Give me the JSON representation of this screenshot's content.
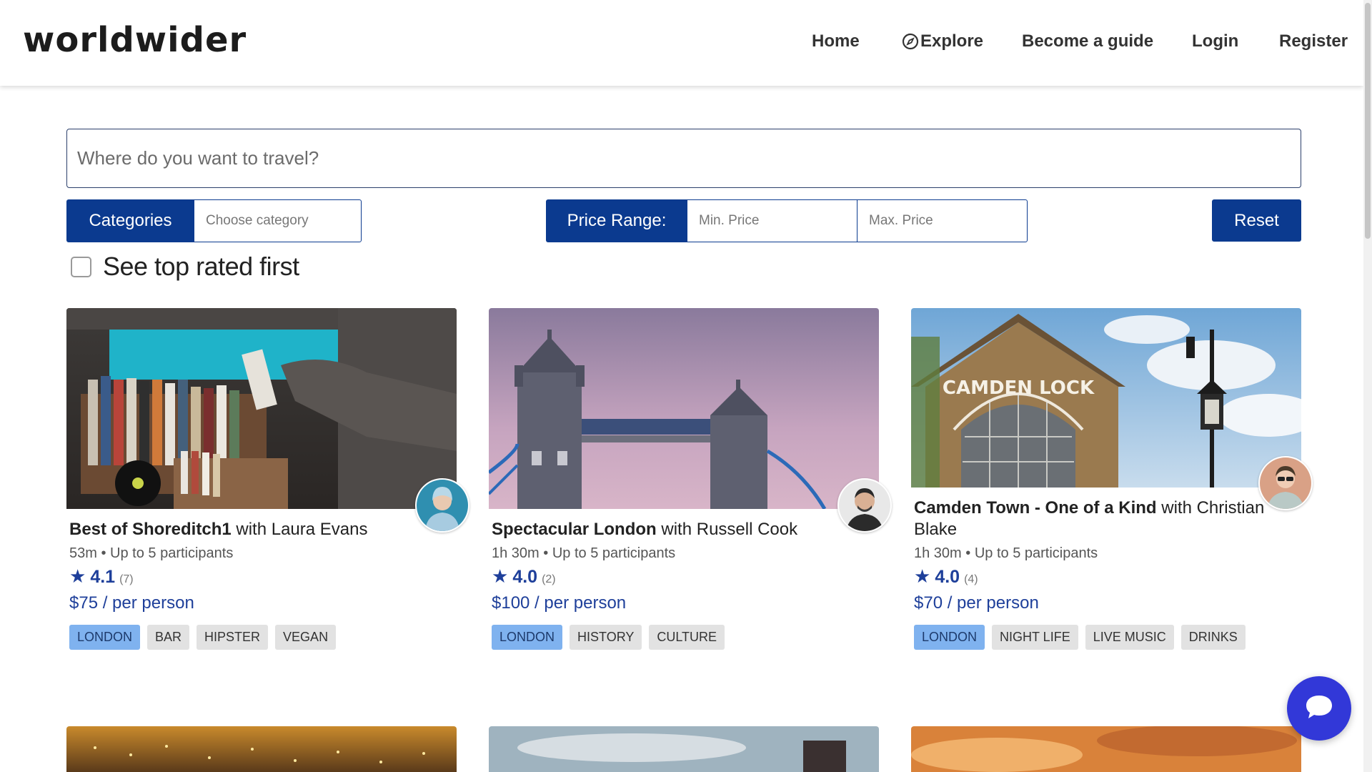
{
  "brand": {
    "logo": "worldwider"
  },
  "nav": {
    "home": "Home",
    "explore": "Explore",
    "become_guide": "Become a guide",
    "login": "Login",
    "register": "Register"
  },
  "search": {
    "placeholder": "Where do you want to travel?"
  },
  "filters": {
    "categories_label": "Categories",
    "category_placeholder": "Choose category",
    "price_label": "Price Range:",
    "min_placeholder": "Min. Price",
    "max_placeholder": "Max. Price",
    "reset_label": "Reset",
    "top_rated_label": "See top rated first",
    "top_rated_checked": false
  },
  "tours": [
    {
      "title": "Best of Shoreditch1",
      "guide_prefix": "with",
      "guide": "Laura Evans",
      "duration": "53m",
      "participants": "Up to 5 participants",
      "rating": "4.1",
      "reviews": "(7)",
      "price": "$75 / per person",
      "tags": [
        "LONDON",
        "BAR",
        "HIPSTER",
        "VEGAN"
      ]
    },
    {
      "title": "Spectacular London",
      "guide_prefix": "with",
      "guide": "Russell Cook",
      "duration": "1h 30m",
      "participants": "Up to 5 participants",
      "rating": "4.0",
      "reviews": "(2)",
      "price": "$100 / per person",
      "tags": [
        "LONDON",
        "HISTORY",
        "CULTURE"
      ]
    },
    {
      "title": "Camden Town - One of a Kind",
      "guide_prefix": "with",
      "guide": "Christian Blake",
      "duration": "1h 30m",
      "participants": "Up to 5 participants",
      "rating": "4.0",
      "reviews": "(4)",
      "price": "$70 / per person",
      "tags": [
        "LONDON",
        "NIGHT LIFE",
        "LIVE MUSIC",
        "DRINKS"
      ]
    }
  ],
  "images": {
    "camden_sign": "CAMDEN LOCK"
  },
  "colors": {
    "primary": "#0b3a8f",
    "accent": "#1e3f9a",
    "tag_primary": "#7fb2ef",
    "chat": "#3238d8"
  },
  "icons": {
    "explore": "compass-icon",
    "rating": "star-icon",
    "chat": "chat-bubble-icon"
  }
}
